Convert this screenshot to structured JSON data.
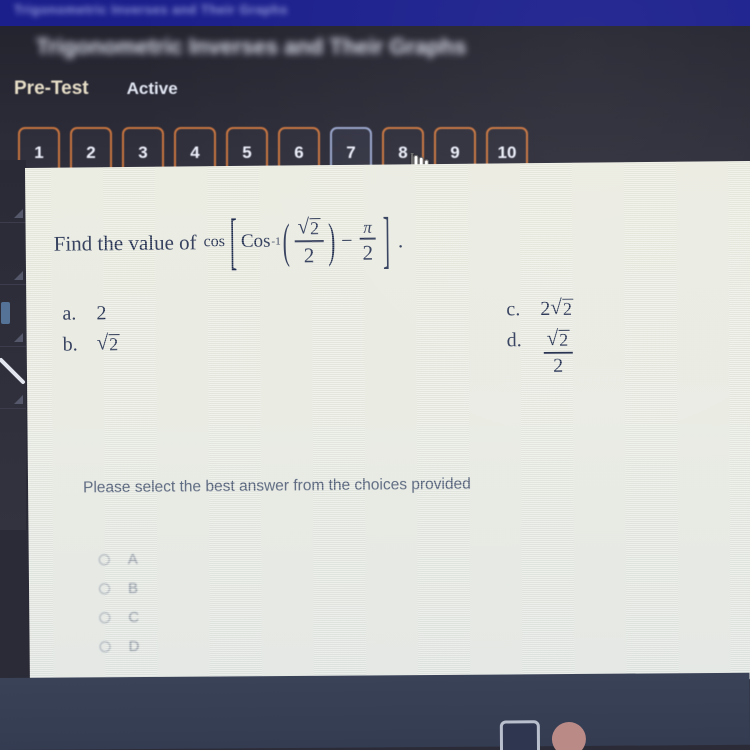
{
  "window": {
    "top_banner_text": "Trigonometric Inverses and Their Graphs",
    "lesson_title": "Trigonometric Inverses and Their Graphs"
  },
  "tabs": {
    "pretest_label": "Pre-Test",
    "status_label": "Active"
  },
  "question_nav": {
    "buttons": [
      "1",
      "2",
      "3",
      "4",
      "5",
      "6",
      "7",
      "8",
      "9",
      "10"
    ],
    "current": "7",
    "border_color": "#c8753f",
    "current_border_color": "#9aa6cc",
    "cursor_icon": "pointing-hand-cursor"
  },
  "question": {
    "stem": "Find the value of",
    "outer_function": "cos",
    "inner_function": "Cos",
    "inner_exponent": "-1",
    "inner_arg_numerator_radicand": "2",
    "inner_arg_denominator": "2",
    "operator": "−",
    "subtrahend_numerator": "π",
    "subtrahend_denominator": "2",
    "trailing_punctuation": ".",
    "open_bracket": "[",
    "close_bracket": "]",
    "open_paren": "(",
    "close_paren": ")",
    "radical_sign": "√"
  },
  "choices": [
    {
      "label": "a.",
      "value": "2",
      "kind": "plain"
    },
    {
      "label": "b.",
      "value": "√2",
      "kind": "radical"
    },
    {
      "label": "c.",
      "value": "2√2",
      "kind": "coef-radical",
      "coefficient": "2"
    },
    {
      "label": "d.",
      "value": "√2 / 2",
      "kind": "fraction",
      "numerator": "√2",
      "denominator": "2"
    }
  ],
  "instruction": {
    "text": "Please select the best answer from the choices provided"
  },
  "answer_options": [
    {
      "label": "A",
      "selected": false
    },
    {
      "label": "B",
      "selected": false
    },
    {
      "label": "C",
      "selected": false
    },
    {
      "label": "D",
      "selected": false
    }
  ],
  "taskbar": {
    "icons": [
      "monitor-icon",
      "circle-avatar-icon"
    ]
  },
  "colors": {
    "chrome_background": "#2b2b37",
    "banner_blue": "#1b1f8c",
    "panel_background": "#edeee3",
    "text_ink": "#1e2b4d",
    "accent_orange": "#c8753f",
    "taskbar": "#3a4258"
  }
}
